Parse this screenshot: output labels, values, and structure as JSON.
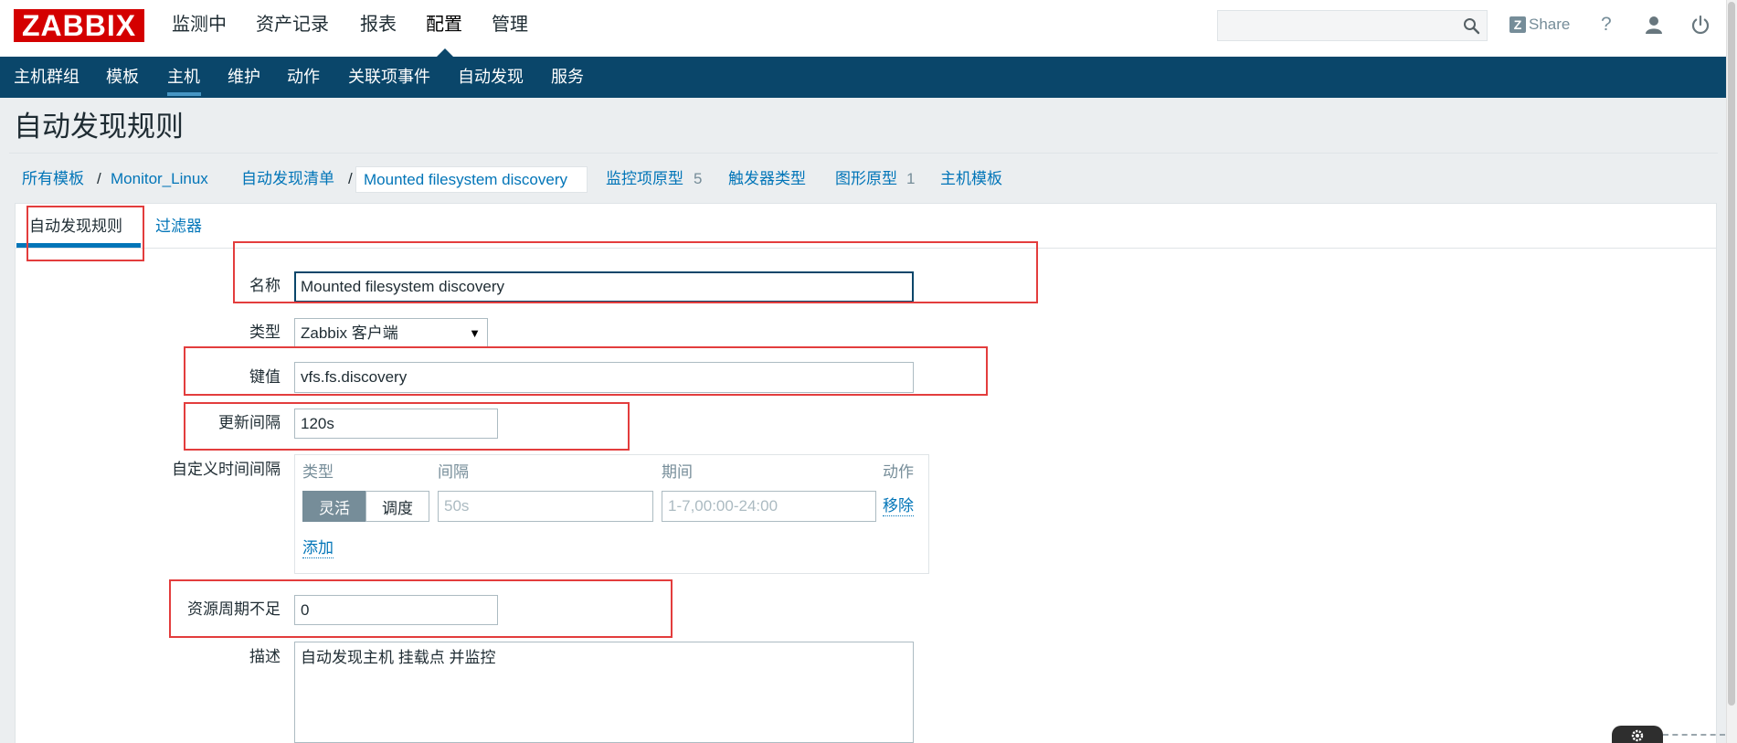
{
  "header": {
    "logo_text": "ZABBIX",
    "menu": [
      {
        "label": "监测中"
      },
      {
        "label": "资产记录"
      },
      {
        "label": "报表"
      },
      {
        "label": "配置",
        "active": true
      },
      {
        "label": "管理"
      }
    ],
    "search": {
      "value": "",
      "icon": "search-icon"
    },
    "share": {
      "logo_letter": "Z",
      "label": "Share"
    },
    "help_label": "?",
    "profile_icon": "user-icon",
    "logout_icon": "power-icon"
  },
  "sub_menu": [
    {
      "label": "主机群组"
    },
    {
      "label": "模板"
    },
    {
      "label": "主机",
      "active": true
    },
    {
      "label": "维护"
    },
    {
      "label": "动作"
    },
    {
      "label": "关联项事件"
    },
    {
      "label": "自动发现"
    },
    {
      "label": "服务"
    }
  ],
  "page_title": "自动发现规则",
  "breadcrumbs": {
    "all_templates": "所有模板",
    "separator": "/",
    "template": "Monitor_Linux",
    "discovery_list": "自动发现清单",
    "current": "Mounted filesystem discovery",
    "item_prototypes": {
      "label": "监控项原型",
      "count": "5"
    },
    "trigger_prototypes": {
      "label": "触发器类型"
    },
    "graph_prototypes": {
      "label": "图形原型",
      "count": "1"
    },
    "host_prototypes": {
      "label": "主机模板"
    }
  },
  "tabs": [
    {
      "label": "自动发现规则",
      "active": true
    },
    {
      "label": "过滤器"
    }
  ],
  "form": {
    "name": {
      "label": "名称",
      "value": "Mounted filesystem discovery"
    },
    "type": {
      "label": "类型",
      "value": "Zabbix 客户端"
    },
    "key": {
      "label": "键值",
      "value": "vfs.fs.discovery"
    },
    "delay": {
      "label": "更新间隔",
      "value": "120s"
    },
    "custom_intervals": {
      "label": "自定义时间间隔",
      "columns": [
        "类型",
        "间隔",
        "期间",
        "动作"
      ],
      "rows": [
        {
          "mode_options": [
            {
              "label": "灵活",
              "selected": true
            },
            {
              "label": "调度"
            }
          ],
          "interval_placeholder": "50s",
          "period_placeholder": "1-7,00:00-24:00",
          "remove_label": "移除"
        }
      ],
      "add_label": "添加"
    },
    "lifetime": {
      "label": "资源周期不足",
      "value": "0"
    },
    "description": {
      "label": "描述",
      "value": "自动发现主机 挂载点 并监控"
    }
  },
  "colors": {
    "logo_bg": "#d40000",
    "nav_bg": "#0a466a",
    "link": "#0275b8",
    "active_button": "#768d99",
    "annotation": "#e33d3d"
  }
}
